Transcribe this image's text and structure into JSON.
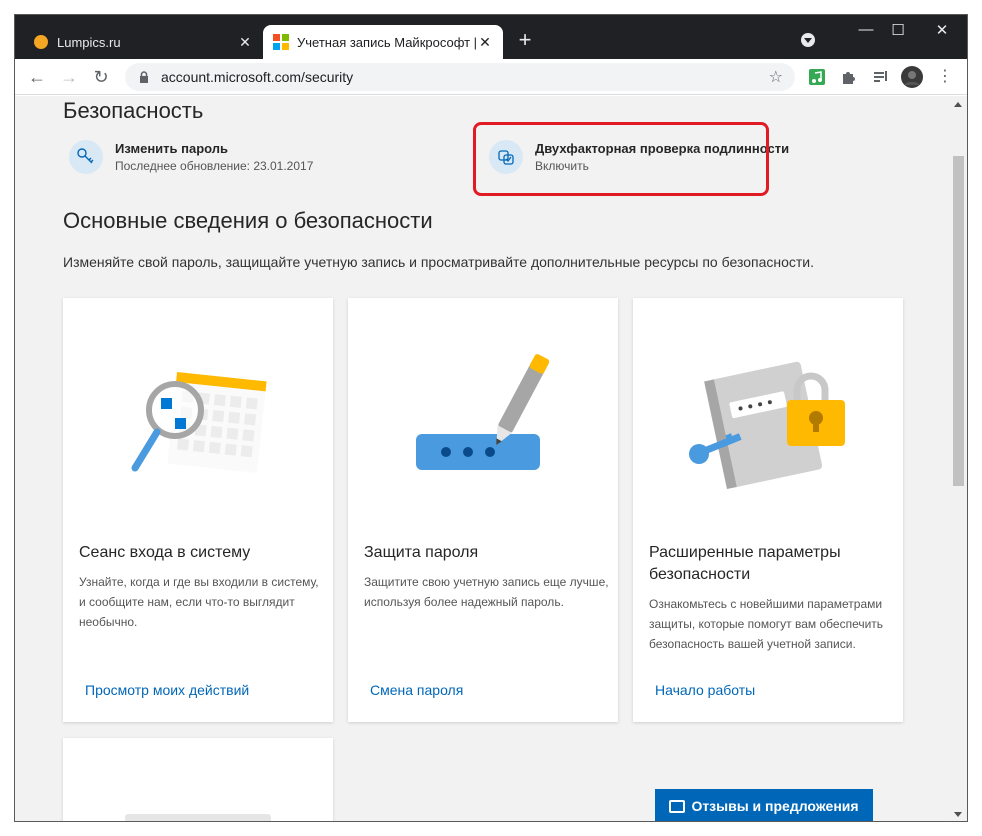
{
  "browser": {
    "tabs": [
      {
        "title": "Lumpics.ru",
        "close": "✕"
      },
      {
        "title": "Учетная запись Майкрософт | Б",
        "close": "✕"
      }
    ],
    "new_tab": "+",
    "window_controls": {
      "minimize": "—",
      "maximize": "☐",
      "close": "✕"
    },
    "url": "account.microsoft.com/security",
    "nav": {
      "back": "←",
      "forward": "→",
      "reload": "↻"
    },
    "accent_colors": {
      "tab_favicon_lumpics": "#f5a623",
      "ms_red": "#f25022",
      "ms_green": "#7fba00",
      "ms_blue": "#00a4ef",
      "ms_yellow": "#ffb900"
    }
  },
  "page": {
    "section_title": "Безопасность",
    "quick_actions": [
      {
        "title": "Изменить пароль",
        "subtitle": "Последнее обновление: 23.01.2017",
        "icon": "key-icon"
      },
      {
        "title": "Двухфакторная проверка подлинности",
        "subtitle": "Включить",
        "icon": "two-step-verification-icon"
      }
    ],
    "basics_title": "Основные сведения о безопасности",
    "basics_intro": "Изменяйте свой пароль, защищайте учетную запись и просматривайте дополнительные ресурсы по безопасности.",
    "cards": [
      {
        "title": "Сеанс входа в систему",
        "description": "Узнайте, когда и где вы входили в систему, и сообщите нам, если что-то выглядит необычно.",
        "link": "Просмотр моих действий",
        "illustration": "calendar-magnifier-icon"
      },
      {
        "title": "Защита пароля",
        "description": "Защитите свою учетную запись еще лучше, используя более надежный пароль.",
        "link": "Смена пароля",
        "illustration": "password-pen-icon"
      },
      {
        "title": "Расширенные параметры безопасности",
        "description": "Ознакомьтесь с новейшими параметрами защиты, которые помогут вам обеспечить безопасность вашей учетной записи.",
        "link": "Начало работы",
        "illustration": "notebook-lock-key-icon"
      }
    ],
    "feedback_button": "Отзывы и предложения"
  }
}
